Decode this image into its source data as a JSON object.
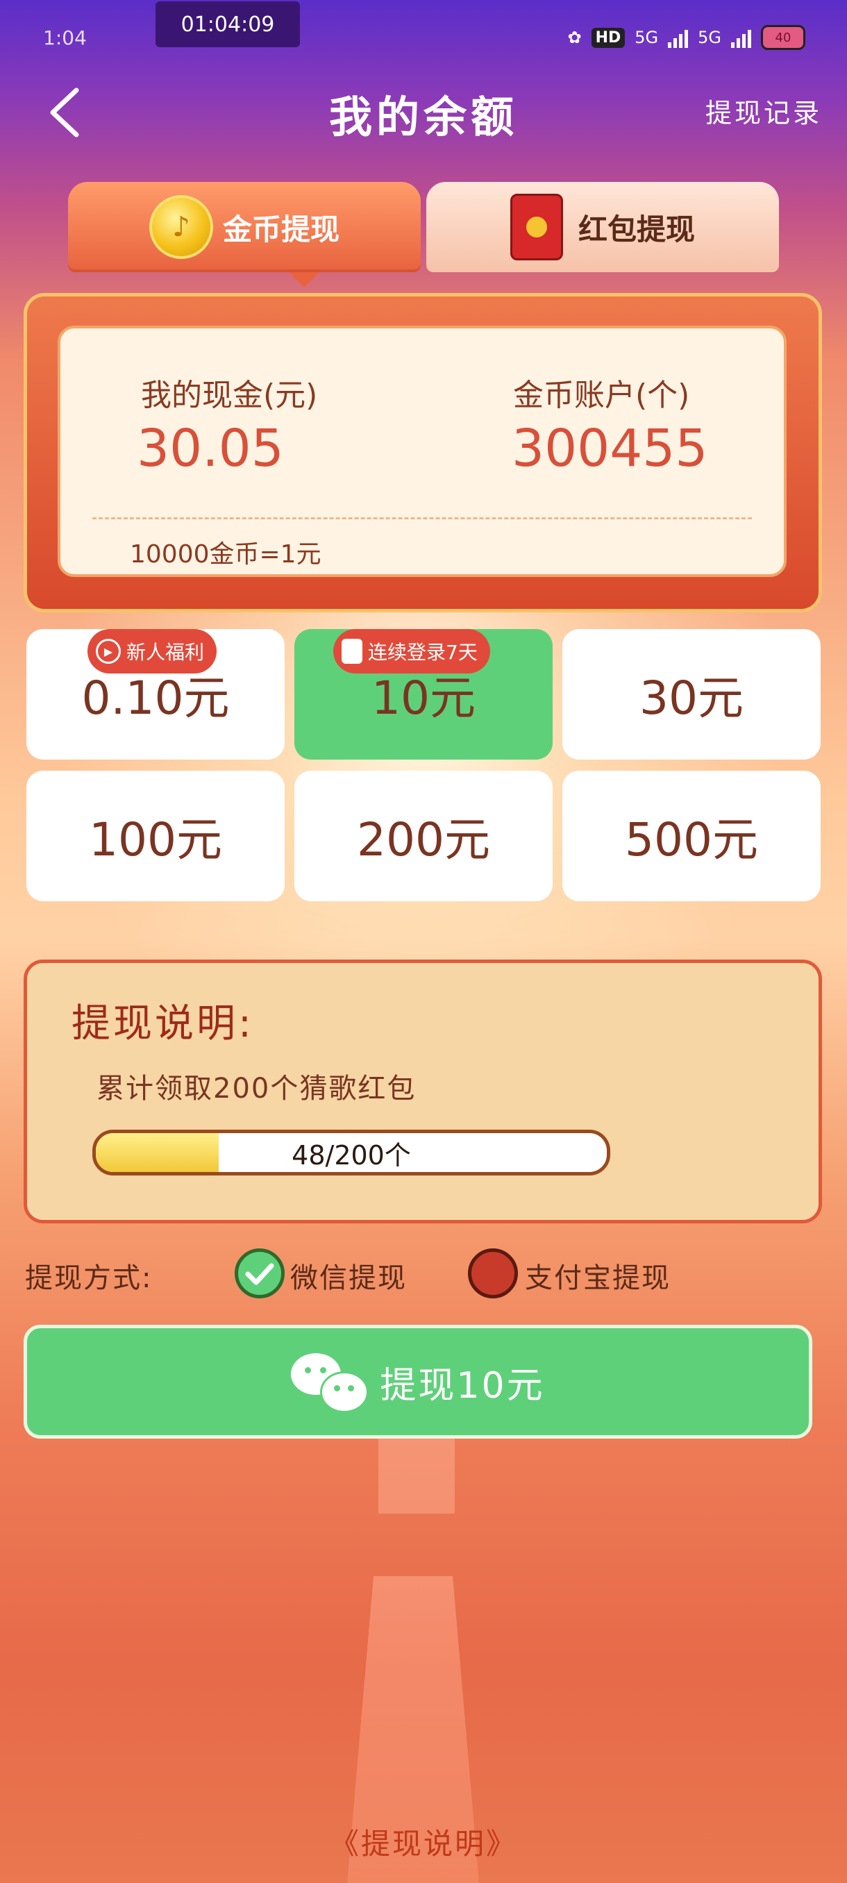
{
  "status_bar": {
    "time": "1:04",
    "timer": "01:04:09",
    "hd": "HD",
    "net1": "5G",
    "net2": "5G",
    "battery": "40"
  },
  "header": {
    "title": "我的余额",
    "record_link": "提现记录"
  },
  "tabs": [
    {
      "label": "金币提现",
      "active": true
    },
    {
      "label": "红包提现",
      "active": false
    }
  ],
  "balance": {
    "cash_label": "我的现金(元)",
    "cash_value": "30.05",
    "coin_label": "金币账户(个)",
    "coin_value": "300455",
    "rate": "10000金币=1元"
  },
  "amounts": [
    {
      "label": "0.10元",
      "badge": "新人福利",
      "selected": false
    },
    {
      "label": "10元",
      "badge": "连续登录7天",
      "selected": true
    },
    {
      "label": "30元",
      "badge": "",
      "selected": false
    },
    {
      "label": "100元",
      "badge": "",
      "selected": false
    },
    {
      "label": "200元",
      "badge": "",
      "selected": false
    },
    {
      "label": "500元",
      "badge": "",
      "selected": false
    }
  ],
  "explanation": {
    "title": "提现说明:",
    "desc": "累计领取200个猜歌红包",
    "progress_text": "48/200个",
    "progress_fraction": 0.24
  },
  "method": {
    "label": "提现方式:",
    "wechat": "微信提现",
    "alipay": "支付宝提现",
    "selected": "wechat"
  },
  "withdraw_button": "提现10元",
  "footer_link": "《提现说明》",
  "colors": {
    "accent_green": "#5fd07a",
    "accent_red": "#e14a3a",
    "value_red": "#d8503a"
  }
}
